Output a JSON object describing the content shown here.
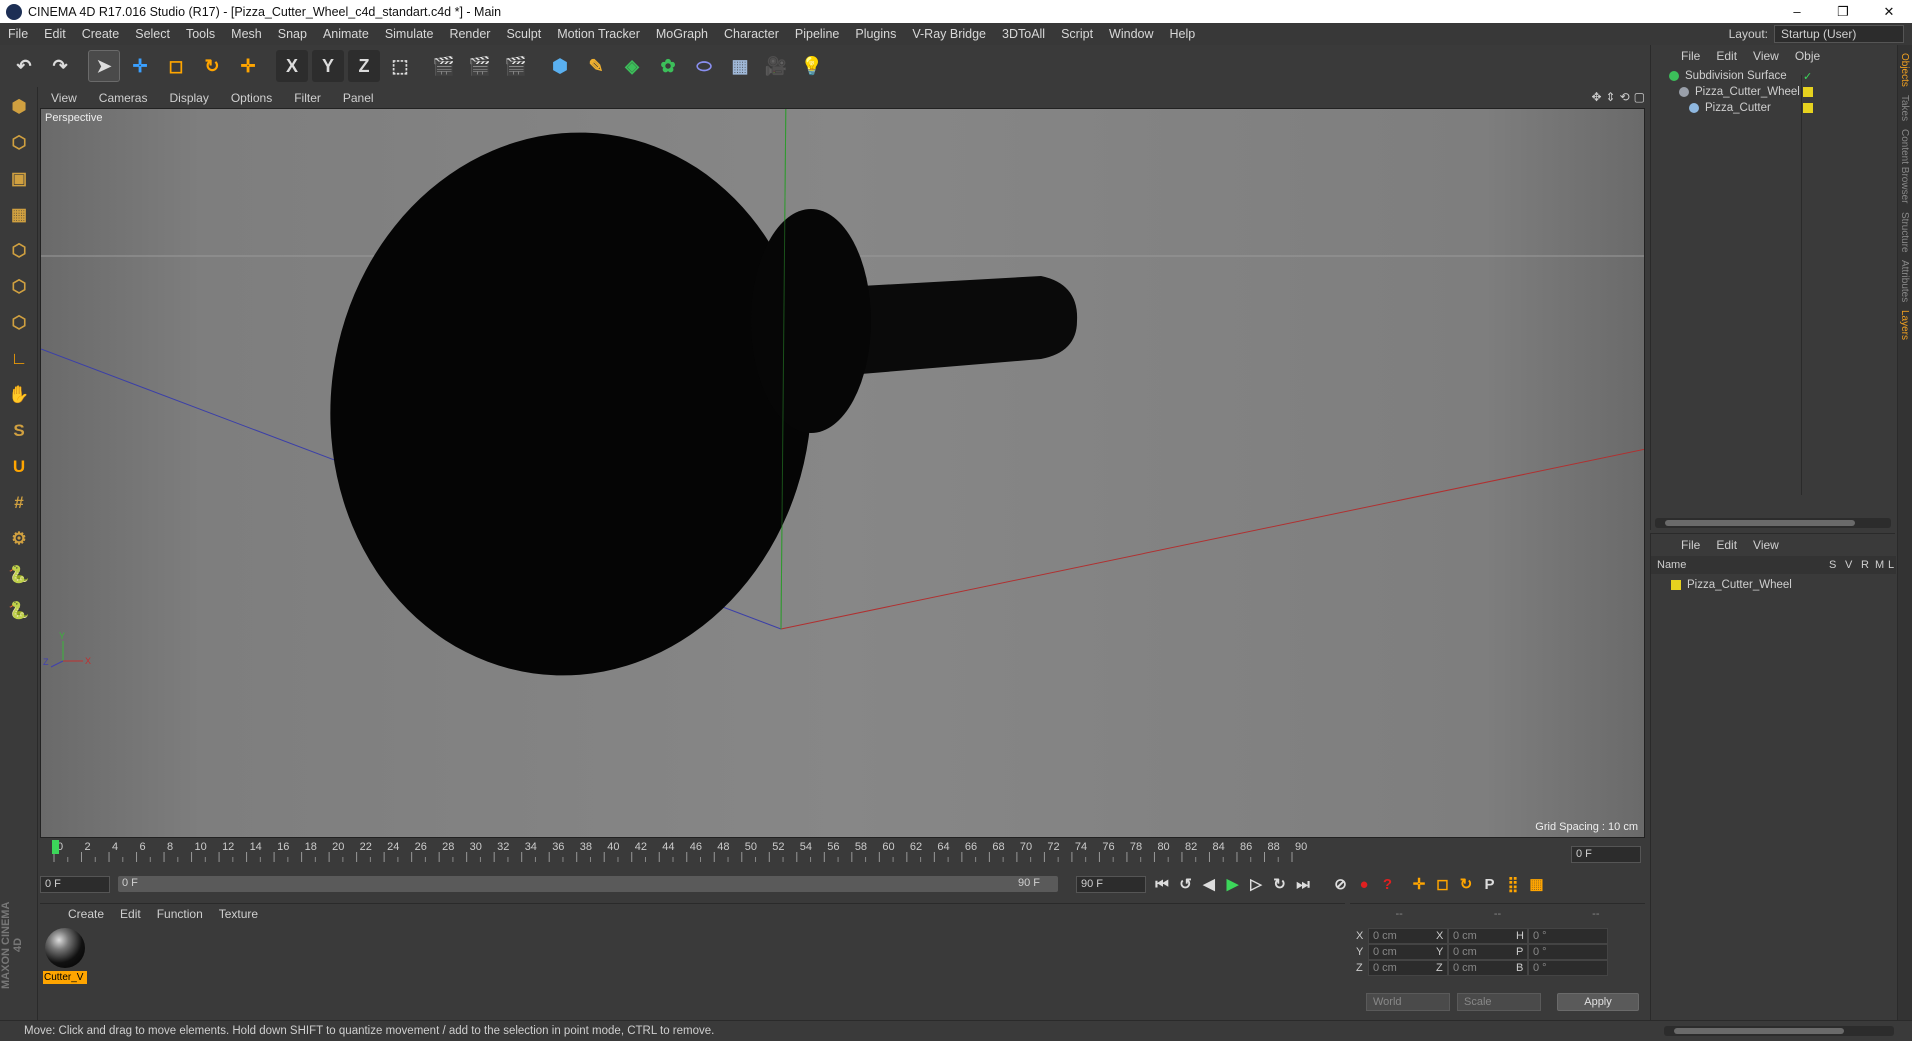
{
  "window": {
    "title": "CINEMA 4D R17.016 Studio (R17) - [Pizza_Cutter_Wheel_c4d_standart.c4d *] - Main",
    "controls": [
      "–",
      "❐",
      "✕"
    ]
  },
  "menubar": {
    "items": [
      "File",
      "Edit",
      "Create",
      "Select",
      "Tools",
      "Mesh",
      "Snap",
      "Animate",
      "Simulate",
      "Render",
      "Sculpt",
      "Motion Tracker",
      "MoGraph",
      "Character",
      "Pipeline",
      "Plugins",
      "V-Ray Bridge",
      "3DToAll",
      "Script",
      "Window",
      "Help"
    ],
    "layout_label": "Layout:",
    "layout_value": "Startup (User)"
  },
  "toolbar": {
    "icons": [
      "undo-icon",
      "redo-icon",
      "select-cursor-icon",
      "move-icon",
      "scale-icon",
      "rotate-icon",
      "live-select-icon",
      "x-axis-icon",
      "y-axis-icon",
      "z-axis-icon",
      "coord-system-icon",
      "render-view-icon",
      "render-picture-viewer-icon",
      "edit-render-settings-icon",
      "cube-icon",
      "pen-icon",
      "subdivision-icon",
      "cloner-icon",
      "deformer-icon",
      "floor-icon",
      "camera-icon",
      "light-icon"
    ],
    "glyphs": [
      "↶",
      "↷",
      "➤",
      "✛",
      "◻",
      "↻",
      "✛",
      "X",
      "Y",
      "Z",
      "⬚",
      "🎬",
      "🎬",
      "🎬",
      "⬢",
      "✎",
      "◈",
      "✿",
      "⬭",
      "▦",
      "🎥",
      "💡"
    ]
  },
  "lefttools": {
    "icons": [
      "make-editable-icon",
      "model-mode-icon",
      "texture-mode-icon",
      "workplane-mode-icon",
      "points-mode-icon",
      "edges-mode-icon",
      "polygons-mode-icon",
      "axis-mode-icon",
      "tweak-mode-icon",
      "solo-icon",
      "snapping-icon",
      "grid-lock-icon",
      "gizmo-icon",
      "python-icon",
      "python-script-icon"
    ],
    "glyphs": [
      "⬢",
      "⬡",
      "▣",
      "▦",
      "⬡",
      "⬡",
      "⬡",
      "∟",
      "✋",
      "S",
      "U",
      "#",
      "⚙",
      "🐍",
      "🐍"
    ],
    "brand_text": "MAXON CINEMA 4D"
  },
  "viewport": {
    "menu": [
      "View",
      "Cameras",
      "Display",
      "Options",
      "Filter",
      "Panel"
    ],
    "label": "Perspective",
    "grid_spacing": "Grid Spacing : 10 cm",
    "nav_glyphs": [
      "✥",
      "⇕",
      "⟲",
      "▢"
    ],
    "axis_x": "X",
    "axis_y": "Y",
    "axis_z": "Z"
  },
  "timeline": {
    "ticks": [
      "0",
      "2",
      "4",
      "6",
      "8",
      "10",
      "12",
      "14",
      "16",
      "18",
      "20",
      "22",
      "24",
      "26",
      "28",
      "30",
      "32",
      "34",
      "36",
      "38",
      "40",
      "42",
      "44",
      "46",
      "48",
      "50",
      "52",
      "54",
      "56",
      "58",
      "60",
      "62",
      "64",
      "66",
      "68",
      "70",
      "72",
      "74",
      "76",
      "78",
      "80",
      "82",
      "84",
      "86",
      "88",
      "90"
    ],
    "current_frame": "0 F",
    "start_frame": "0 F",
    "slider_start": "0 F",
    "slider_end": "90 F",
    "end_frame": "90 F",
    "end_frame2": "90 F",
    "playback_glyphs": [
      "⏮",
      "↺",
      "◀",
      "▶",
      "▷",
      "↻",
      "⏭",
      "⊘",
      "●",
      "?",
      "✛",
      "◻",
      "↻",
      "P",
      "⣿",
      "▦"
    ]
  },
  "materials": {
    "menu": [
      "Create",
      "Edit",
      "Function",
      "Texture"
    ],
    "items": [
      {
        "name": "Cutter_V"
      }
    ]
  },
  "coordinates": {
    "headers": [
      "--",
      "--",
      "--"
    ],
    "rows": [
      {
        "a": "X",
        "av": "0 cm",
        "b": "X",
        "bv": "0 cm",
        "c": "H",
        "cv": "0 °"
      },
      {
        "a": "Y",
        "av": "0 cm",
        "b": "Y",
        "bv": "0 cm",
        "c": "P",
        "cv": "0 °"
      },
      {
        "a": "Z",
        "av": "0 cm",
        "b": "Z",
        "bv": "0 cm",
        "c": "B",
        "cv": "0 °"
      }
    ],
    "mode1": "World",
    "mode2": "Scale",
    "apply": "Apply"
  },
  "object_manager": {
    "menu": [
      "File",
      "Edit",
      "View",
      "Obje"
    ],
    "objects": [
      {
        "name": "Subdivision Surface",
        "color": "#3cbf5a"
      },
      {
        "name": "Pizza_Cutter_Wheel",
        "color": "#9aa0aa"
      },
      {
        "name": "Pizza_Cutter",
        "color": "#8fb8e0"
      }
    ]
  },
  "layer_manager": {
    "menu": [
      "File",
      "Edit",
      "View"
    ],
    "headers": {
      "name": "Name",
      "s": "S",
      "v": "V",
      "r": "R",
      "m": "M",
      "l": "L"
    },
    "rows": [
      {
        "name": "Pizza_Cutter_Wheel",
        "color": "#e6d21f"
      }
    ]
  },
  "side_tabs": [
    "Objects",
    "Takes",
    "Content Browser",
    "Structure",
    "Attributes",
    "Layers"
  ],
  "status": "Move: Click and drag to move elements. Hold down SHIFT to quantize movement / add to the selection in point mode, CTRL to remove."
}
